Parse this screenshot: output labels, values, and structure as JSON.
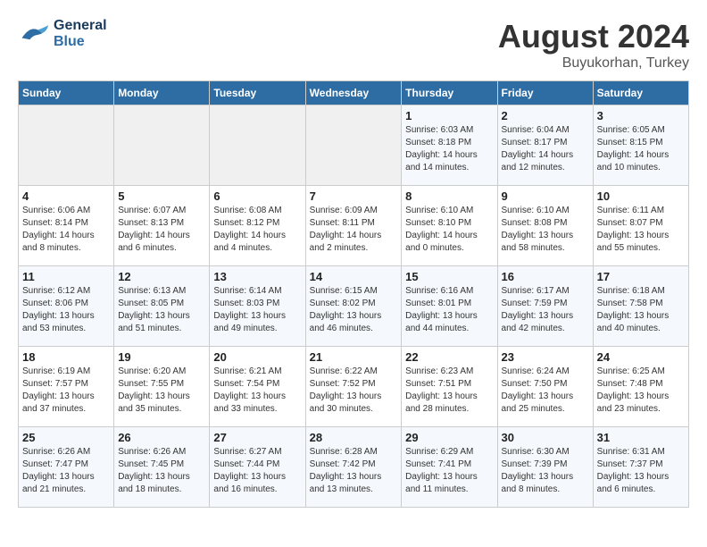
{
  "header": {
    "logo_line1": "General",
    "logo_line2": "Blue",
    "month_year": "August 2024",
    "location": "Buyukorhan, Turkey"
  },
  "days_of_week": [
    "Sunday",
    "Monday",
    "Tuesday",
    "Wednesday",
    "Thursday",
    "Friday",
    "Saturday"
  ],
  "weeks": [
    [
      {
        "day": "",
        "info": ""
      },
      {
        "day": "",
        "info": ""
      },
      {
        "day": "",
        "info": ""
      },
      {
        "day": "",
        "info": ""
      },
      {
        "day": "1",
        "info": "Sunrise: 6:03 AM\nSunset: 8:18 PM\nDaylight: 14 hours\nand 14 minutes."
      },
      {
        "day": "2",
        "info": "Sunrise: 6:04 AM\nSunset: 8:17 PM\nDaylight: 14 hours\nand 12 minutes."
      },
      {
        "day": "3",
        "info": "Sunrise: 6:05 AM\nSunset: 8:15 PM\nDaylight: 14 hours\nand 10 minutes."
      }
    ],
    [
      {
        "day": "4",
        "info": "Sunrise: 6:06 AM\nSunset: 8:14 PM\nDaylight: 14 hours\nand 8 minutes."
      },
      {
        "day": "5",
        "info": "Sunrise: 6:07 AM\nSunset: 8:13 PM\nDaylight: 14 hours\nand 6 minutes."
      },
      {
        "day": "6",
        "info": "Sunrise: 6:08 AM\nSunset: 8:12 PM\nDaylight: 14 hours\nand 4 minutes."
      },
      {
        "day": "7",
        "info": "Sunrise: 6:09 AM\nSunset: 8:11 PM\nDaylight: 14 hours\nand 2 minutes."
      },
      {
        "day": "8",
        "info": "Sunrise: 6:10 AM\nSunset: 8:10 PM\nDaylight: 14 hours\nand 0 minutes."
      },
      {
        "day": "9",
        "info": "Sunrise: 6:10 AM\nSunset: 8:08 PM\nDaylight: 13 hours\nand 58 minutes."
      },
      {
        "day": "10",
        "info": "Sunrise: 6:11 AM\nSunset: 8:07 PM\nDaylight: 13 hours\nand 55 minutes."
      }
    ],
    [
      {
        "day": "11",
        "info": "Sunrise: 6:12 AM\nSunset: 8:06 PM\nDaylight: 13 hours\nand 53 minutes."
      },
      {
        "day": "12",
        "info": "Sunrise: 6:13 AM\nSunset: 8:05 PM\nDaylight: 13 hours\nand 51 minutes."
      },
      {
        "day": "13",
        "info": "Sunrise: 6:14 AM\nSunset: 8:03 PM\nDaylight: 13 hours\nand 49 minutes."
      },
      {
        "day": "14",
        "info": "Sunrise: 6:15 AM\nSunset: 8:02 PM\nDaylight: 13 hours\nand 46 minutes."
      },
      {
        "day": "15",
        "info": "Sunrise: 6:16 AM\nSunset: 8:01 PM\nDaylight: 13 hours\nand 44 minutes."
      },
      {
        "day": "16",
        "info": "Sunrise: 6:17 AM\nSunset: 7:59 PM\nDaylight: 13 hours\nand 42 minutes."
      },
      {
        "day": "17",
        "info": "Sunrise: 6:18 AM\nSunset: 7:58 PM\nDaylight: 13 hours\nand 40 minutes."
      }
    ],
    [
      {
        "day": "18",
        "info": "Sunrise: 6:19 AM\nSunset: 7:57 PM\nDaylight: 13 hours\nand 37 minutes."
      },
      {
        "day": "19",
        "info": "Sunrise: 6:20 AM\nSunset: 7:55 PM\nDaylight: 13 hours\nand 35 minutes."
      },
      {
        "day": "20",
        "info": "Sunrise: 6:21 AM\nSunset: 7:54 PM\nDaylight: 13 hours\nand 33 minutes."
      },
      {
        "day": "21",
        "info": "Sunrise: 6:22 AM\nSunset: 7:52 PM\nDaylight: 13 hours\nand 30 minutes."
      },
      {
        "day": "22",
        "info": "Sunrise: 6:23 AM\nSunset: 7:51 PM\nDaylight: 13 hours\nand 28 minutes."
      },
      {
        "day": "23",
        "info": "Sunrise: 6:24 AM\nSunset: 7:50 PM\nDaylight: 13 hours\nand 25 minutes."
      },
      {
        "day": "24",
        "info": "Sunrise: 6:25 AM\nSunset: 7:48 PM\nDaylight: 13 hours\nand 23 minutes."
      }
    ],
    [
      {
        "day": "25",
        "info": "Sunrise: 6:26 AM\nSunset: 7:47 PM\nDaylight: 13 hours\nand 21 minutes."
      },
      {
        "day": "26",
        "info": "Sunrise: 6:26 AM\nSunset: 7:45 PM\nDaylight: 13 hours\nand 18 minutes."
      },
      {
        "day": "27",
        "info": "Sunrise: 6:27 AM\nSunset: 7:44 PM\nDaylight: 13 hours\nand 16 minutes."
      },
      {
        "day": "28",
        "info": "Sunrise: 6:28 AM\nSunset: 7:42 PM\nDaylight: 13 hours\nand 13 minutes."
      },
      {
        "day": "29",
        "info": "Sunrise: 6:29 AM\nSunset: 7:41 PM\nDaylight: 13 hours\nand 11 minutes."
      },
      {
        "day": "30",
        "info": "Sunrise: 6:30 AM\nSunset: 7:39 PM\nDaylight: 13 hours\nand 8 minutes."
      },
      {
        "day": "31",
        "info": "Sunrise: 6:31 AM\nSunset: 7:37 PM\nDaylight: 13 hours\nand 6 minutes."
      }
    ]
  ]
}
